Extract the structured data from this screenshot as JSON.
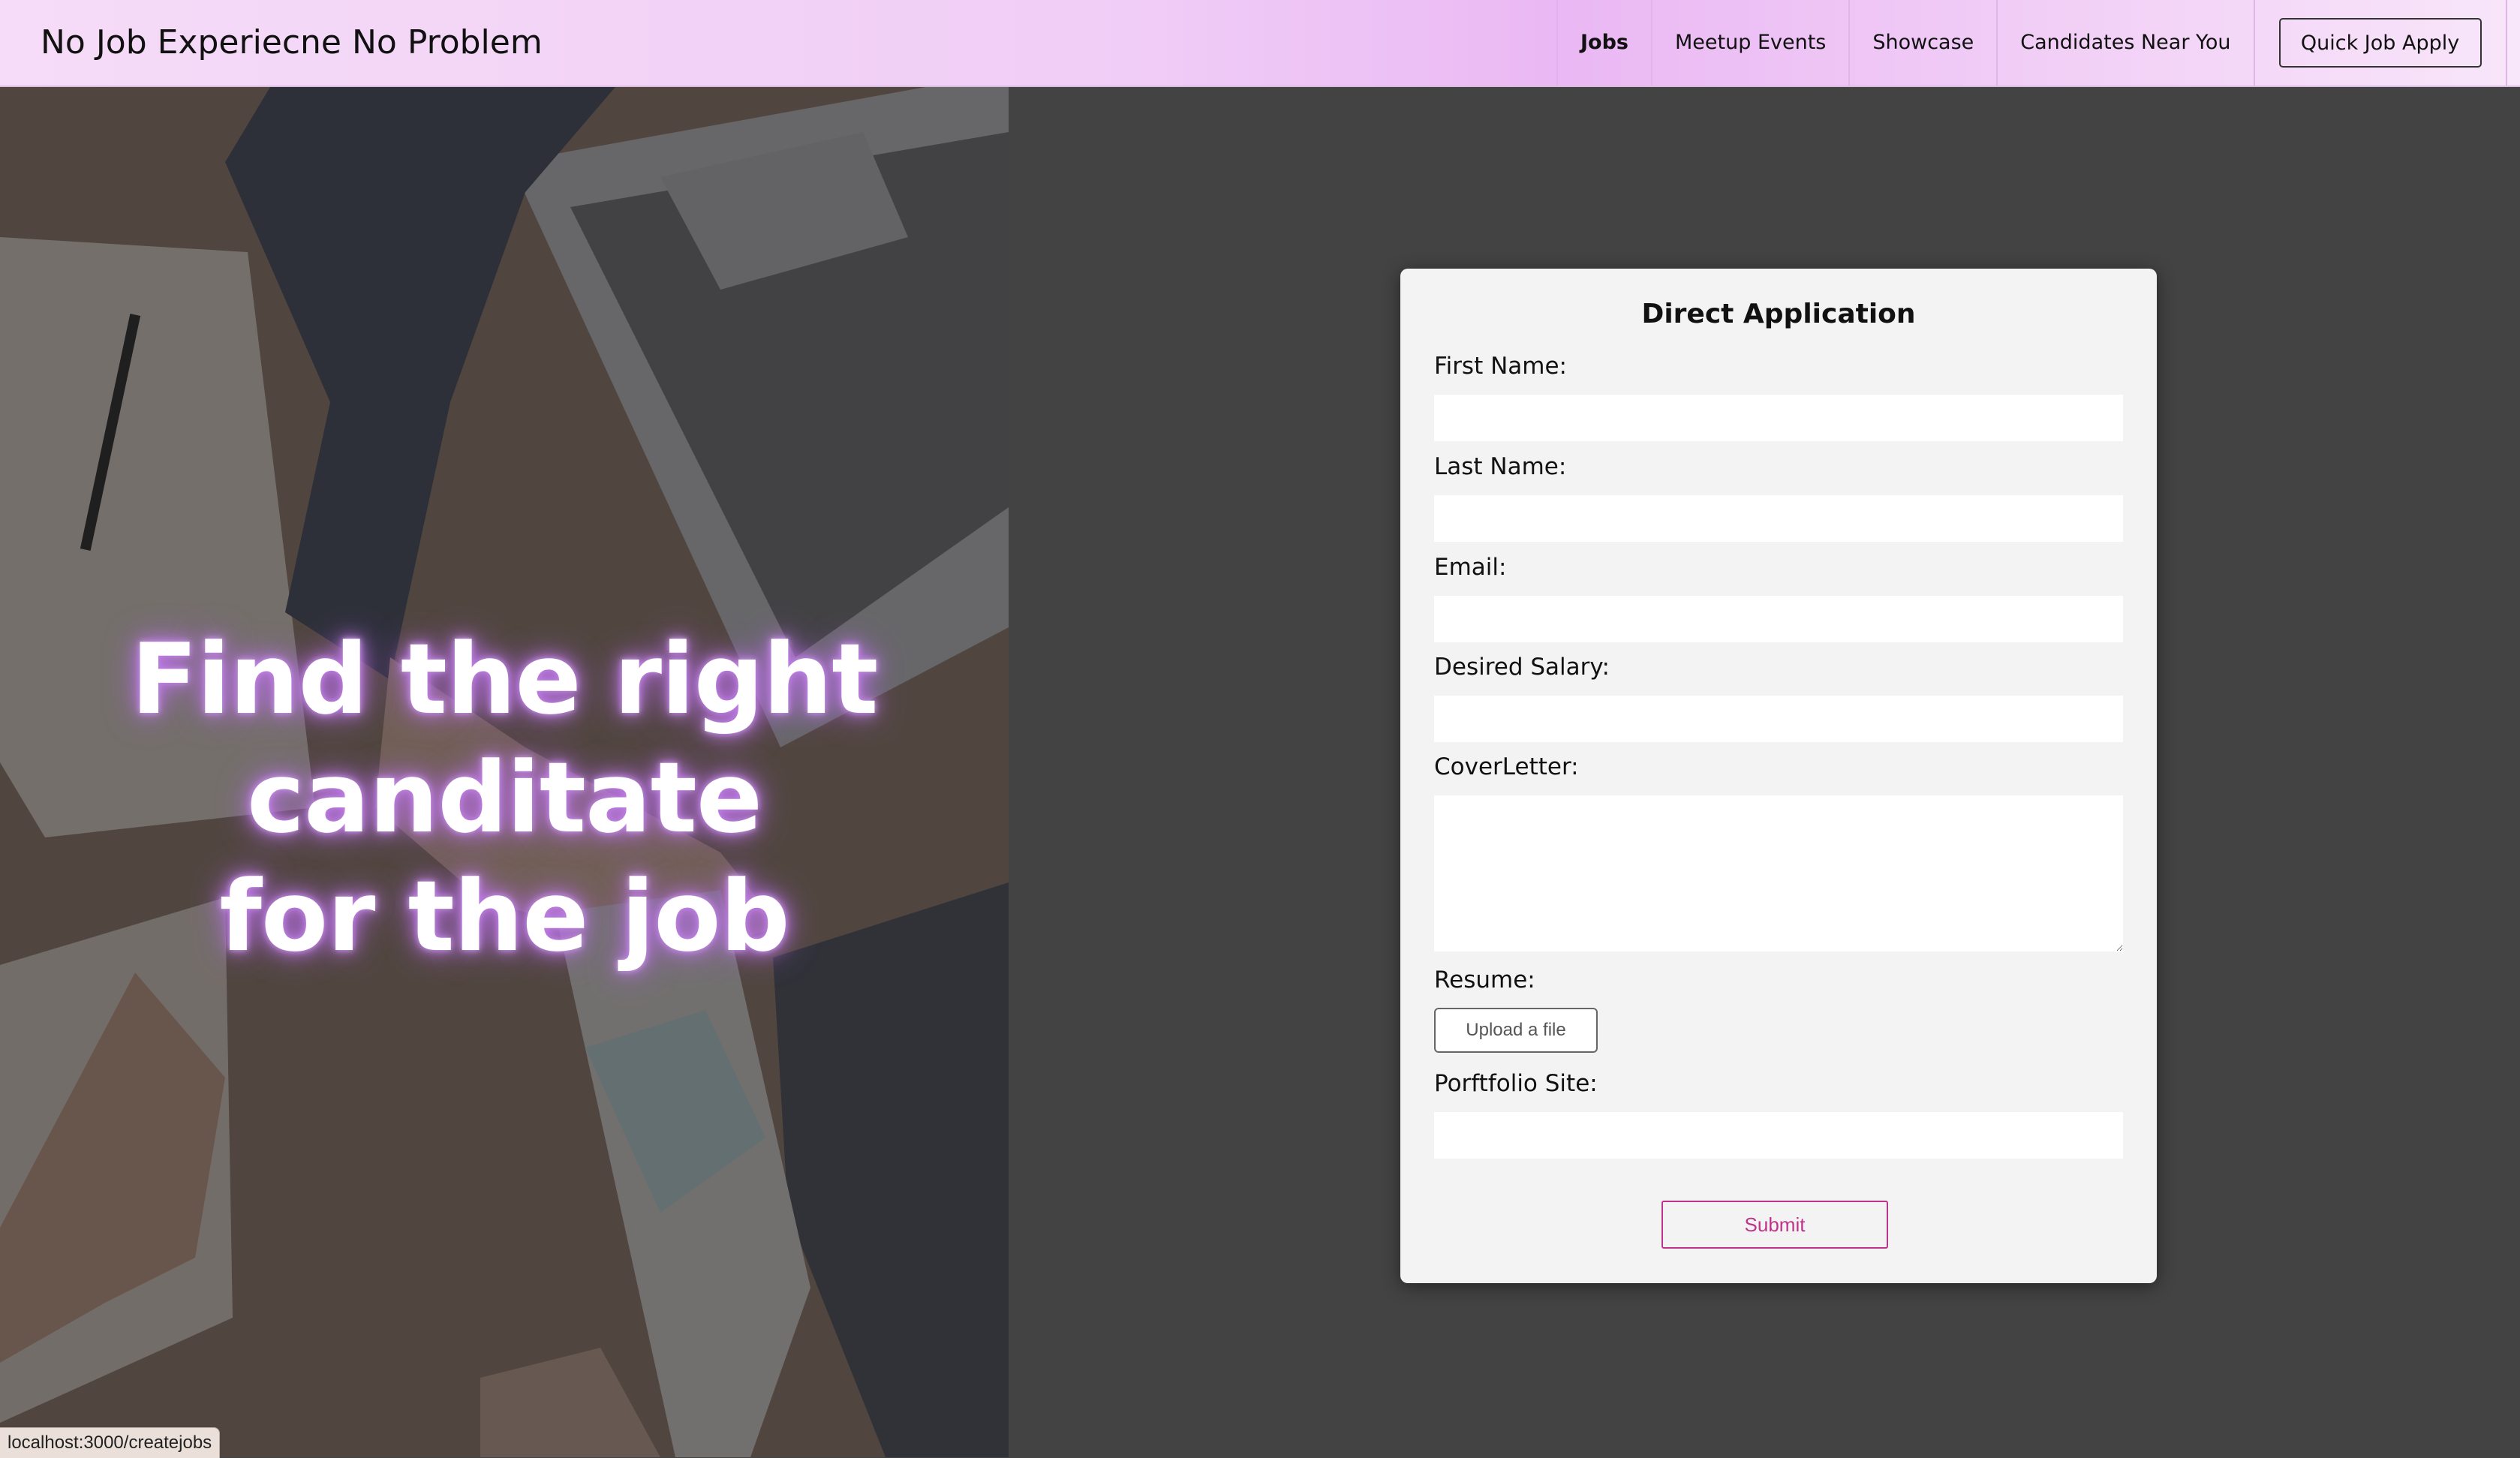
{
  "header": {
    "brand": "No Job Experiecne No Problem",
    "nav": [
      {
        "label": "Jobs",
        "active": true
      },
      {
        "label": "Meetup Events",
        "active": false
      },
      {
        "label": "Showcase",
        "active": false
      },
      {
        "label": "Candidates Near You",
        "active": false
      }
    ],
    "cta_label": "Quick Job Apply"
  },
  "hero": {
    "title_line1": "Find the right canditate",
    "title_line2": "for the job"
  },
  "form": {
    "title": "Direct Application",
    "first_name_label": "First Name:",
    "first_name_value": "",
    "last_name_label": "Last Name:",
    "last_name_value": "",
    "email_label": "Email:",
    "email_value": "",
    "salary_label": "Desired Salary:",
    "salary_value": "",
    "cover_letter_label": "CoverLetter:",
    "cover_letter_value": "",
    "resume_label": "Resume:",
    "upload_label": "Upload a file",
    "portfolio_label": "Porftfolio Site:",
    "portfolio_value": "",
    "submit_label": "Submit"
  },
  "status_bar": {
    "url": "localhost:3000/createjobs"
  },
  "colors": {
    "page_background": "#434343",
    "card_background": "#f3f3f3",
    "accent": "#c0338a",
    "hero_glow": "#b066e0"
  }
}
